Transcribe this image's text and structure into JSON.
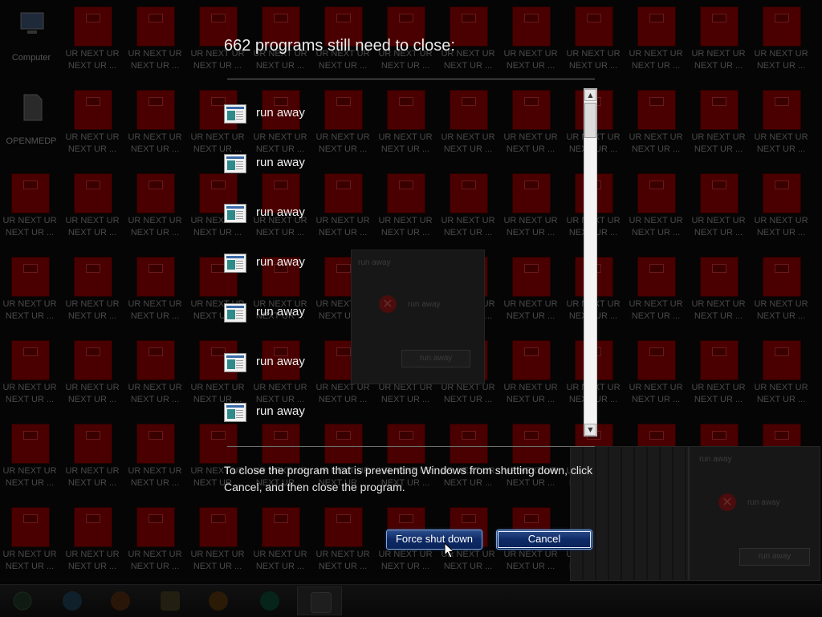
{
  "desktop": {
    "system_icons": [
      {
        "label": "Computer",
        "icon": "computer-icon"
      },
      {
        "label": "OPENMEDP",
        "icon": "document-icon"
      }
    ],
    "shortcut_label": "UR NEXT UR\nNEXT UR ...",
    "shortcut_label_short": "UR NEXT UR\nNEXT UR ...",
    "shortcut_color": "#4a0000"
  },
  "ghost_dialogs": [
    {
      "title": "run away",
      "message": "run away",
      "button": "run away"
    },
    {
      "title": "run away",
      "message": "run away",
      "button": "run away"
    }
  ],
  "shutdown_screen": {
    "heading": "662 programs still need to close:",
    "programs": [
      {
        "label": "run away",
        "icon": "application-window-icon"
      },
      {
        "label": "run away",
        "icon": "application-window-icon"
      },
      {
        "label": "run away",
        "icon": "application-window-icon"
      },
      {
        "label": "run away",
        "icon": "application-window-icon"
      },
      {
        "label": "run away",
        "icon": "application-window-icon"
      },
      {
        "label": "run away",
        "icon": "application-window-icon"
      },
      {
        "label": "run away",
        "icon": "application-window-icon"
      }
    ],
    "instructions": "To close the program that is preventing Windows from shutting down, click Cancel, and then close the program.",
    "buttons": {
      "force": "Force shut down",
      "cancel": "Cancel"
    },
    "colors": {
      "button_blue": "#0e2a66",
      "text": "#ececec",
      "overlay": "#050505"
    }
  },
  "taskbar": {
    "apps": [
      "start-orb-icon",
      "internet-explorer-icon",
      "media-player-icon",
      "folder-icon",
      "paint-icon",
      "chrome-icon",
      "program-window-icon"
    ]
  }
}
